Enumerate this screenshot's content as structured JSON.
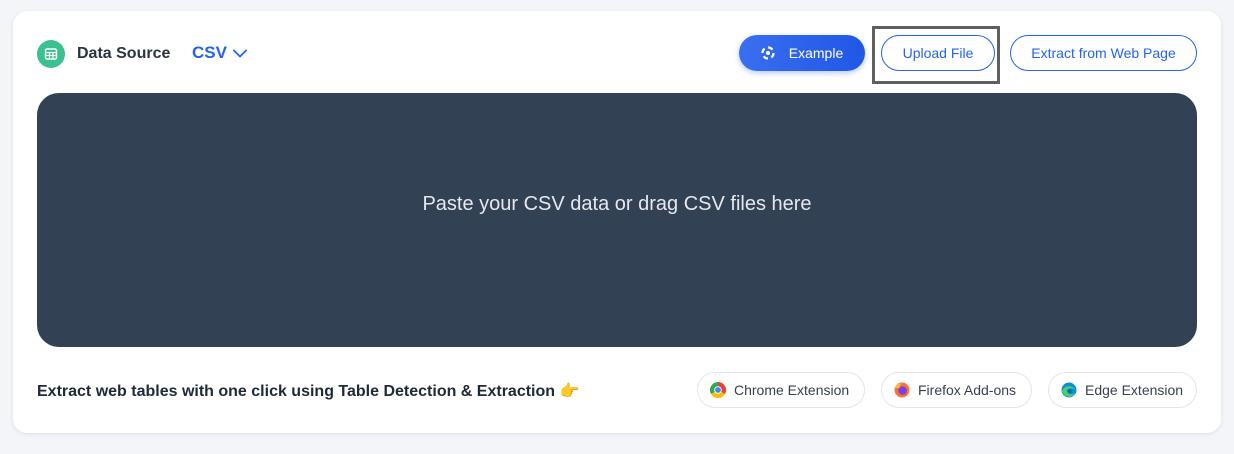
{
  "header": {
    "title": "Data Source",
    "format": "CSV",
    "example_label": "Example",
    "upload_label": "Upload File",
    "extract_label": "Extract from Web Page"
  },
  "dropzone": {
    "placeholder": "Paste your CSV data or drag CSV files here"
  },
  "footer": {
    "promo_text": "Extract web tables with one click using Table Detection & Extraction 👉",
    "extensions": [
      {
        "label": "Chrome Extension",
        "icon": "chrome-icon"
      },
      {
        "label": "Firefox Add-ons",
        "icon": "firefox-icon"
      },
      {
        "label": "Edge Extension",
        "icon": "edge-icon"
      }
    ]
  },
  "colors": {
    "accent": "#2563eb",
    "dropzone_bg": "#334155",
    "data_source_icon": "#3bc08f"
  }
}
